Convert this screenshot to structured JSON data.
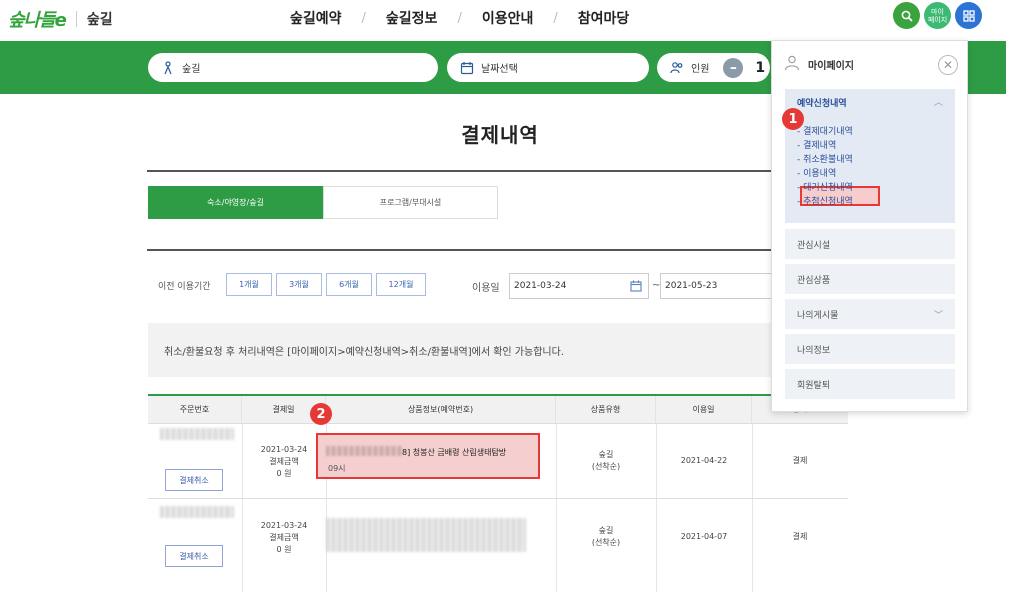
{
  "header": {
    "logo_mark": "숲나들e",
    "logo_sub": "숲길",
    "nav": [
      "숲길예약",
      "숲길정보",
      "이용안내",
      "참여마당"
    ],
    "nav_separator": "/",
    "icons": {
      "search_icon": "search-icon",
      "mypage_label": "마이\n페이지",
      "grid_icon": "grid-icon"
    }
  },
  "search_bar": {
    "trail": "숲길",
    "date": "날짜선택",
    "people_label": "인원",
    "people_count": "1"
  },
  "main": {
    "title": "결제내역",
    "tabs": [
      "숙소/야영장/숲길",
      "프로그램/부대시설"
    ],
    "filter": {
      "period_label": "이전 이용기간",
      "periods": [
        "1개월",
        "3개월",
        "6개월",
        "12개월"
      ],
      "use_date_label": "이용일",
      "date_from": "2021-03-24",
      "date_tilde": "~",
      "date_to": "2021-05-23"
    },
    "notice": "취소/환불요청 후 처리내역은 [마이페이지>예약신청내역>취소/환불내역]에서 확인 가능합니다.",
    "table": {
      "headers": [
        "주문번호",
        "결제일",
        "상품정보(예약번호)",
        "상품유형",
        "이용일",
        "상태"
      ],
      "rows": [
        {
          "pay_date": "2021-03-24",
          "pay_amount_label": "결제금액",
          "pay_amount": "0 원",
          "product_title": "8] 청봉산 금배령 산림생태탐방",
          "product_sub": "09시",
          "type": "숲길",
          "type_sub": "(선착순)",
          "use_date": "2021-04-22",
          "status": "결제",
          "cancel": "결제취소"
        },
        {
          "pay_date": "2021-03-24",
          "pay_amount_label": "결제금액",
          "pay_amount": "0 원",
          "type": "숲길",
          "type_sub": "(선착순)",
          "use_date": "2021-04-07",
          "status": "결제",
          "cancel": "결제취소"
        }
      ]
    }
  },
  "panel": {
    "title": "마이페이지",
    "open_section": "예약신청내역",
    "sub_items": [
      "- 결제대기내역",
      "- 결제내역",
      "- 취소환불내역",
      "- 이용내역",
      "- 대기신청내역",
      "- 추첨신청내역"
    ],
    "rows": [
      "관심시설",
      "관심상품",
      "나의게시물",
      "나의정보",
      "회원탈퇴"
    ]
  },
  "badges": [
    "1",
    "2"
  ],
  "colors": {
    "brand_green": "#2e9c45",
    "highlight_red": "#e53935",
    "link_blue": "#2a4f9a"
  }
}
